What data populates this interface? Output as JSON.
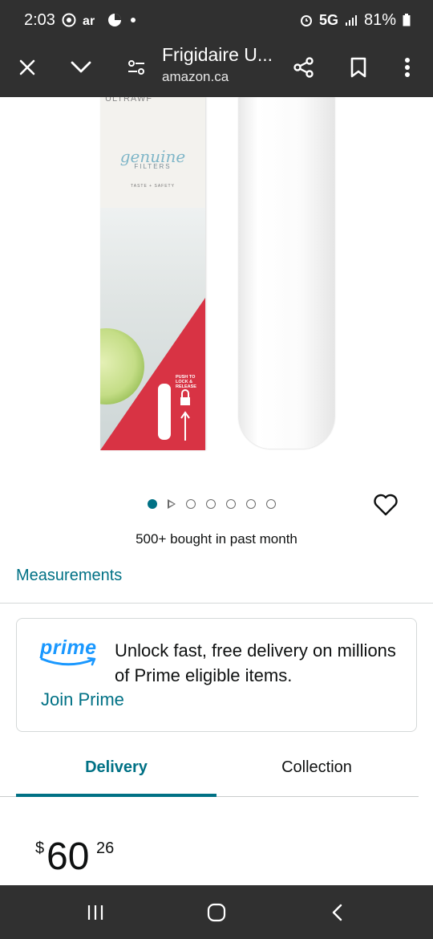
{
  "status_bar": {
    "time": "2:03",
    "network": "5G",
    "battery": "81%",
    "icons": [
      "chrome-icon",
      "air-icon",
      "cloud-icon",
      "dot-icon",
      "alarm-icon",
      "signal-icon",
      "battery-icon"
    ]
  },
  "browser": {
    "title": "Frigidaire U...",
    "url": "amazon.ca",
    "icons": [
      "close-icon",
      "chevron-down-icon",
      "tune-icon",
      "share-icon",
      "bookmark-icon",
      "more-vert-icon"
    ]
  },
  "product_image": {
    "box_brand": "ULTRAWF",
    "box_logo": "genuine",
    "box_logo_sub": "FILTERS",
    "box_tagline": "TASTE + SAFETY",
    "box_push": [
      "PUSH TO",
      "LOCK &",
      "RELEASE"
    ]
  },
  "carousel": {
    "count": 7,
    "active_index": 0,
    "video_index": 1
  },
  "bought_text": "500+ bought in past month",
  "measurements_link": "Measurements",
  "prime": {
    "logo": "prime",
    "text": "Unlock fast, free delivery on millions of Prime eligible items.",
    "join": "Join Prime"
  },
  "tabs": [
    {
      "label": "Delivery",
      "active": true
    },
    {
      "label": "Collection",
      "active": false
    }
  ],
  "price": {
    "currency": "$",
    "whole": "60",
    "fraction": "26"
  },
  "colors": {
    "accent": "#007185",
    "prime_blue": "#1a98ff",
    "chrome_bar": "#303030",
    "red": "#d83344"
  },
  "nav": {
    "icons": [
      "recents-icon",
      "home-icon",
      "back-icon"
    ]
  }
}
